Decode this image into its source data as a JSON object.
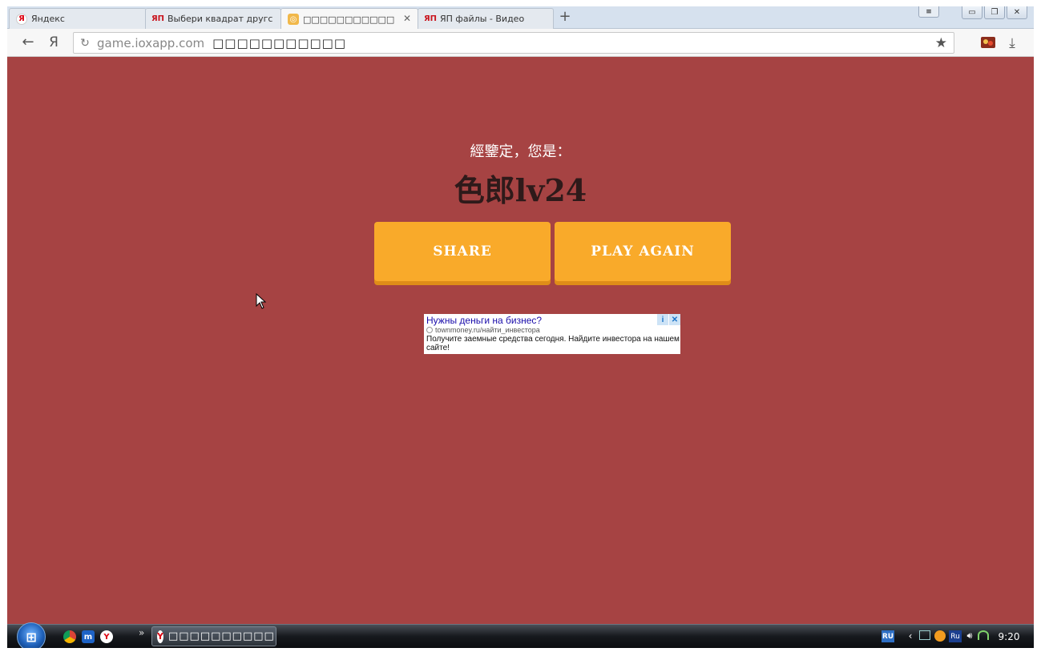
{
  "browser": {
    "tabs": [
      {
        "label": "Яндекс",
        "icon": "yandex-icon",
        "active": false
      },
      {
        "label": "Выбери квадрат другс",
        "icon": "yap-icon",
        "active": false
      },
      {
        "label": "□□□□□□□□□□□",
        "icon": "game-icon",
        "active": true
      },
      {
        "label": "ЯП файлы - Видео",
        "icon": "yap-icon",
        "active": false
      }
    ],
    "new_tab": "+",
    "fav_letters": {
      "yandex": "Я",
      "yap": "ЯП",
      "game": "◎"
    },
    "close_glyph": "✕"
  },
  "window_controls": {
    "minimize": "▭",
    "restore": "❐",
    "close": "✕",
    "menu": "≡"
  },
  "toolbar": {
    "back_glyph": "←",
    "yandex_glyph": "Я",
    "reload_glyph": "↻",
    "address_host": "game.ioxapp.com",
    "address_title": "□□□□□□□□□□□",
    "star_glyph": "★",
    "download_glyph": "⤓"
  },
  "page": {
    "result_label": "經鑒定，您是：",
    "result_title": "色郎lv24",
    "share_label": "SHARE",
    "play_again_label": "PLAY AGAIN"
  },
  "ad": {
    "headline": "Нужны деньги на бизнес?",
    "url": "townmoney.ru/найти_инвестора",
    "body": "Получите заемные средства сегодня. Найдите инвестора на нашем сайте!",
    "info_glyph": "i",
    "close_glyph": "✕"
  },
  "taskbar": {
    "task_label": "□□□□□□□□□□...",
    "task_icon_letter": "Y",
    "chevrons": "»",
    "lang": "RU",
    "ru_badge": "Ru",
    "clock": "9:20",
    "start_glyph": "⊞"
  },
  "colors": {
    "page_background": "#a64343",
    "button": "#f9aa2a",
    "button_shadow": "#df8d18",
    "title_text": "#2e1a1a"
  }
}
